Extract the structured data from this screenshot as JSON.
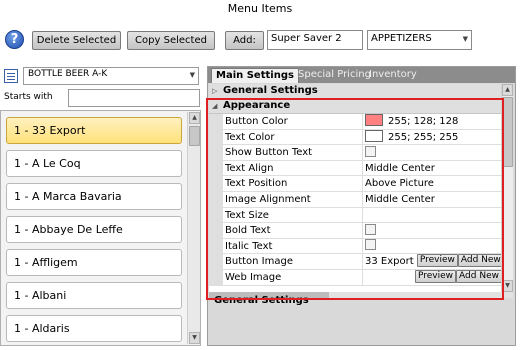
{
  "window": {
    "title": "Menu Items"
  },
  "toolbar": {
    "help_icon": "question-mark-icon",
    "help_glyph": "?",
    "delete_label": "Delete Selected",
    "copy_label": "Copy Selected",
    "add_label": "Add:",
    "add_value": "Super Saver 2",
    "category_value": "APPETIZERS"
  },
  "left": {
    "group_value": "BOTTLE BEER A-K",
    "starts_with_label": "Starts with",
    "starts_with_value": "",
    "items": [
      "1 - 33 Export",
      "1 - A Le Coq",
      "1 - A Marca Bavaria",
      "1 - Abbaye De Leffe",
      "1 - Affligem",
      "1 - Albani",
      "1 - Aldaris"
    ],
    "selected_index": 0
  },
  "right": {
    "tabs": [
      {
        "label": "Main Settings",
        "active": true
      },
      {
        "label": "Special Pricing",
        "active": false
      },
      {
        "label": "Inventory",
        "active": false
      }
    ],
    "categories": [
      {
        "label": "General Settings",
        "expanded": false
      },
      {
        "label": "Appearance",
        "expanded": true
      }
    ],
    "properties": [
      {
        "name": "Button Color",
        "type": "color",
        "value": "255; 128; 128",
        "swatch": "#ff8080"
      },
      {
        "name": "Text Color",
        "type": "color",
        "value": "255; 255; 255",
        "swatch": "#ffffff"
      },
      {
        "name": "Show Button Text",
        "type": "checkbox",
        "value": ""
      },
      {
        "name": "Text Align",
        "type": "text",
        "value": "Middle Center"
      },
      {
        "name": "Text Position",
        "type": "text",
        "value": "Above Picture"
      },
      {
        "name": "Image Alignment",
        "type": "text",
        "value": "Middle Center"
      },
      {
        "name": "Text Size",
        "type": "text",
        "value": ""
      },
      {
        "name": "Bold Text",
        "type": "checkbox",
        "value": ""
      },
      {
        "name": "Italic Text",
        "type": "checkbox",
        "value": ""
      },
      {
        "name": "Button Image",
        "type": "image",
        "value": "33 Export",
        "preview_label": "Preview",
        "add_label": "Add New"
      },
      {
        "name": "Web Image",
        "type": "image",
        "value": "",
        "preview_label": "Preview",
        "add_label": "Add New"
      }
    ],
    "description_title": "General Settings"
  },
  "colors": {
    "highlight_box": "#e02020",
    "selected_item": "#ffe17a",
    "tab_bar": "#8c8c8c"
  }
}
